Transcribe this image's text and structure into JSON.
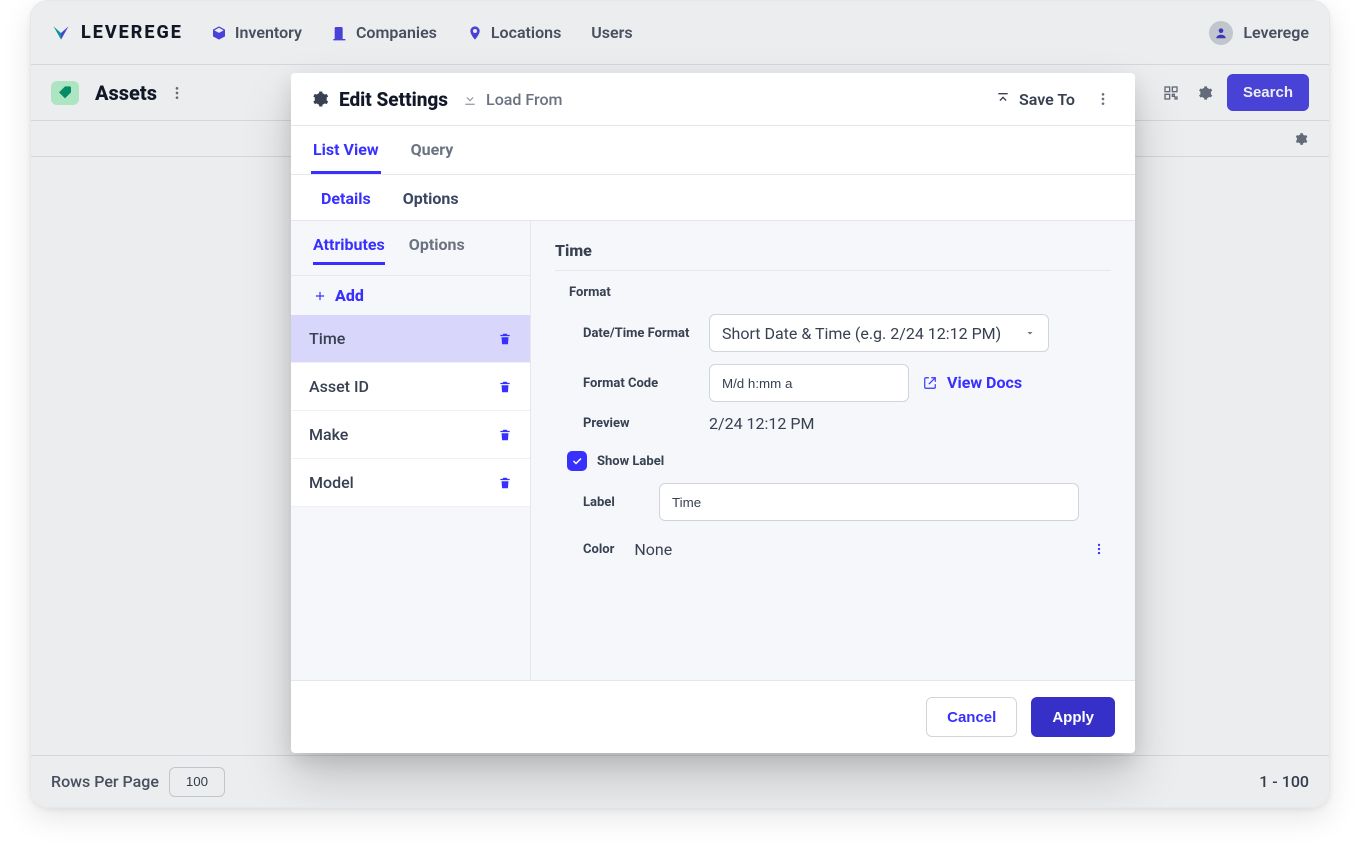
{
  "brand": "LEVEREGE",
  "nav": {
    "inventory": "Inventory",
    "companies": "Companies",
    "locations": "Locations",
    "users": "Users"
  },
  "user": {
    "name": "Leverege"
  },
  "page": {
    "title": "Assets",
    "search": "Search"
  },
  "footer": {
    "rpp_label": "Rows Per Page",
    "rpp_value": "100",
    "range": "1 - 100"
  },
  "modal": {
    "title": "Edit Settings",
    "load_from": "Load From",
    "save_to": "Save To",
    "tabs": {
      "list_view": "List View",
      "query": "Query"
    },
    "subtabs": {
      "details": "Details",
      "options": "Options"
    },
    "attr_tabs": {
      "attributes": "Attributes",
      "options": "Options"
    },
    "add": "Add",
    "attributes": [
      "Time",
      "Asset ID",
      "Make",
      "Model"
    ],
    "panel": {
      "heading": "Time",
      "format_group": "Format",
      "dt_format_label": "Date/Time Format",
      "dt_format_value": "Short Date & Time (e.g. 2/24 12:12 PM)",
      "format_code_label": "Format Code",
      "format_code_value": "M/d h:mm a",
      "view_docs": "View Docs",
      "preview_label": "Preview",
      "preview_value": "2/24 12:12 PM",
      "show_label_label": "Show Label",
      "label_label": "Label",
      "label_value": "Time",
      "color_label": "Color",
      "color_value": "None"
    },
    "cancel": "Cancel",
    "apply": "Apply"
  }
}
